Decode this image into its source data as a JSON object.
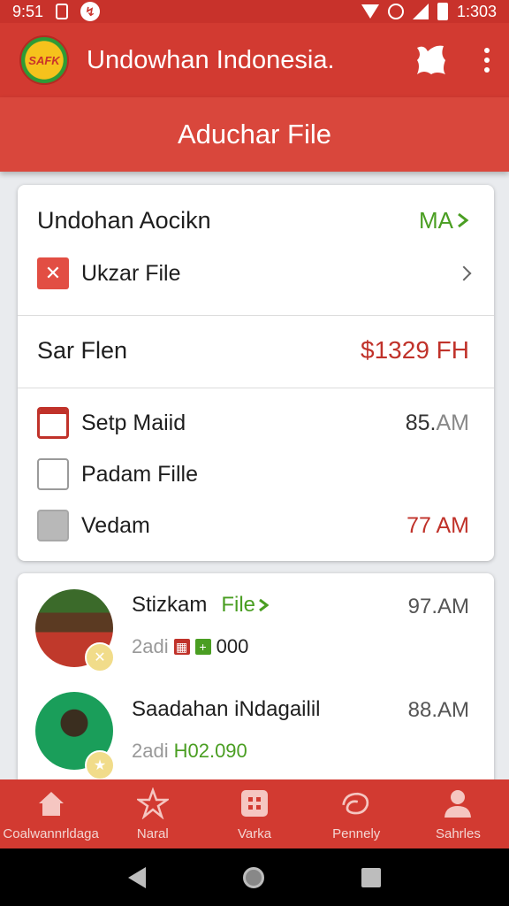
{
  "status_bar": {
    "time": "9:51",
    "clock": "1:303"
  },
  "app_bar": {
    "logo_text": "SAFK",
    "title": "Undowhan Indonesia."
  },
  "sub_header": {
    "title": "Aduchar File"
  },
  "card1": {
    "header_title": "Undohan Aocikn",
    "header_action": "MA",
    "file_row_label": "Ukzar File",
    "summary_label": "Sar Flen",
    "summary_value": "$1329 FH",
    "items": [
      {
        "label": "Setp Maiid",
        "time_main": "85.",
        "time_suffix": "AM"
      },
      {
        "label": "Padam Fille",
        "time_main": "",
        "time_suffix": ""
      },
      {
        "label": "Vedam",
        "time_main": "77 AM",
        "time_suffix": ""
      }
    ]
  },
  "chats": [
    {
      "name": "Stizkam",
      "tag": "File",
      "time": "97.AM",
      "sub_prefix": "2adi",
      "sub_value": "000"
    },
    {
      "name": "Saadahan iNdagailil",
      "tag": "",
      "time": "88.AM",
      "sub_prefix": "2adi",
      "sub_value": "H02.090"
    }
  ],
  "bottom_nav": [
    {
      "label": "Coalwannrldaga",
      "icon": "home-icon"
    },
    {
      "label": "Naral",
      "icon": "star-icon"
    },
    {
      "label": "Varka",
      "icon": "grid-icon"
    },
    {
      "label": "Pennely",
      "icon": "swirl-icon"
    },
    {
      "label": "Sahrles",
      "icon": "person-icon"
    }
  ],
  "colors": {
    "primary": "#d23a31",
    "green": "#4a9e22",
    "red_text": "#c0322a"
  }
}
